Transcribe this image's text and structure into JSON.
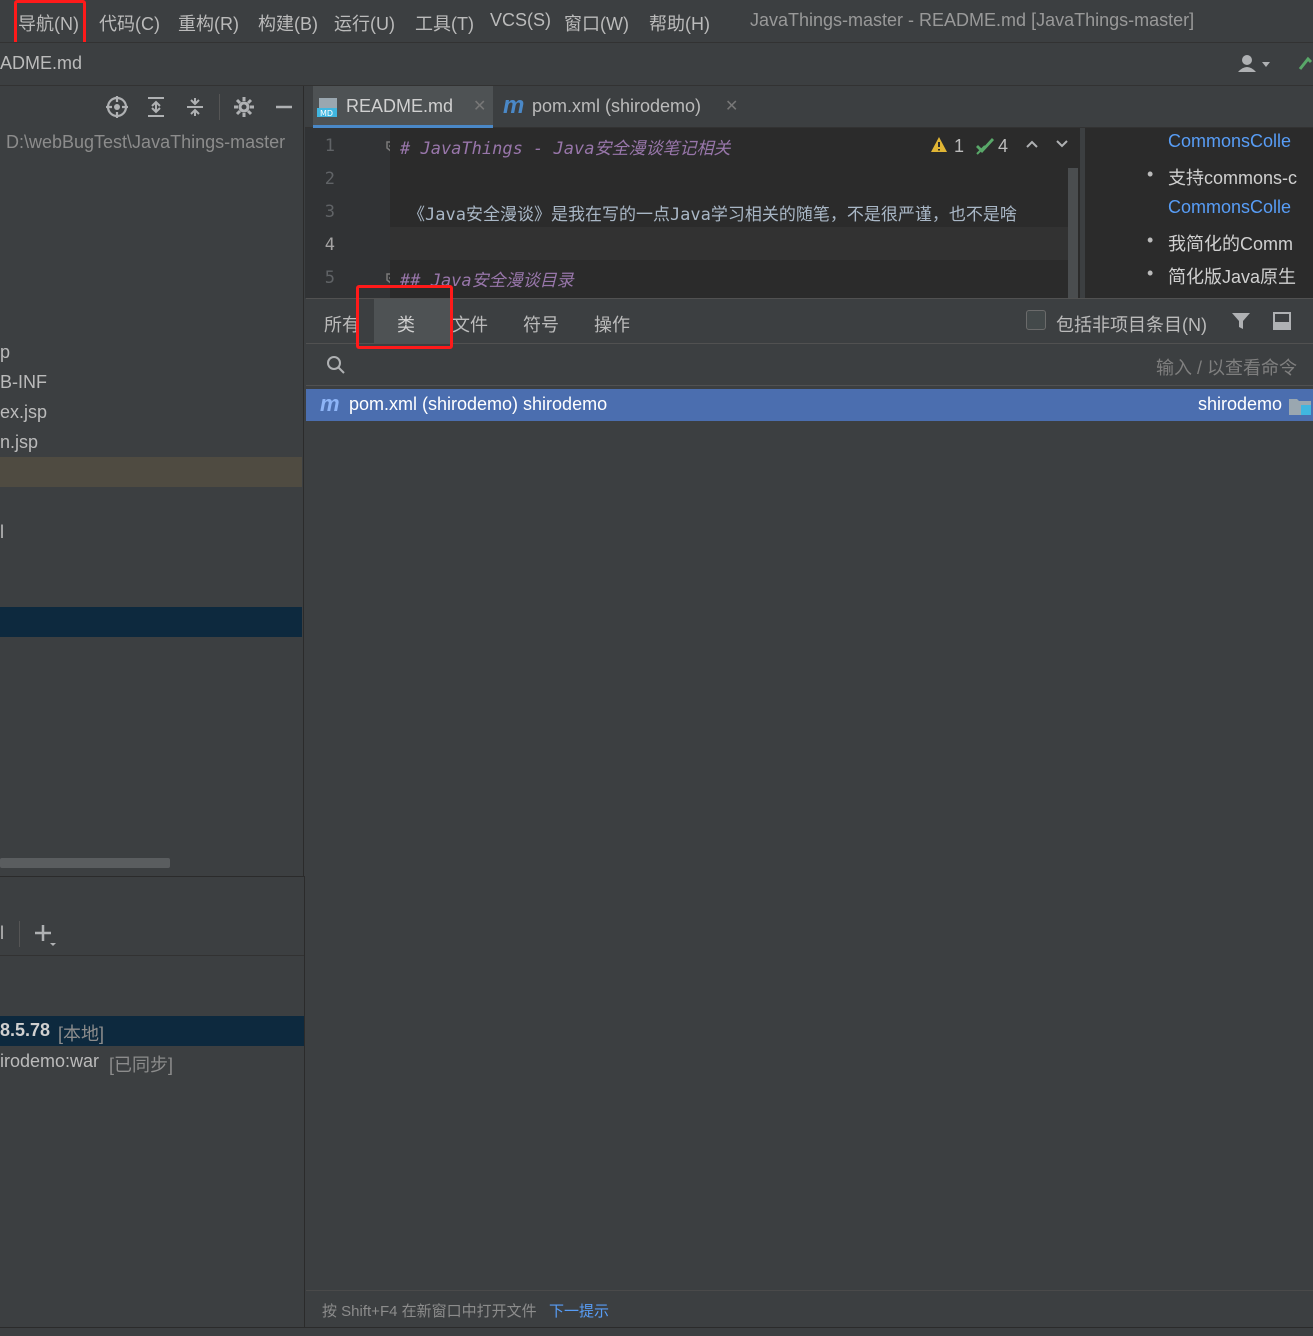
{
  "menu": {
    "items": [
      {
        "label": "导航(N)"
      },
      {
        "label": "代码(C)"
      },
      {
        "label": "重构(R)"
      },
      {
        "label": "构建(B)"
      },
      {
        "label": "运行(U)"
      },
      {
        "label": "工具(T)"
      },
      {
        "label": "VCS(S)"
      },
      {
        "label": "窗口(W)"
      },
      {
        "label": "帮助(H)"
      }
    ],
    "window_title": "JavaThings-master - README.md [JavaThings-master]"
  },
  "navbar": {
    "breadcrumb": "ADME.md"
  },
  "project": {
    "path": "D:\\webBugTest\\JavaThings-master",
    "tree": [
      "p",
      "B-INF",
      "ex.jsp",
      "n.jsp",
      "l"
    ]
  },
  "services": {
    "tab_fragment": "l",
    "items": [
      {
        "name": "8.5.78",
        "tag": "[本地]"
      },
      {
        "name": "irodemo:war",
        "tag": "[已同步]"
      }
    ]
  },
  "editor": {
    "tabs": [
      {
        "label": "README.md",
        "icon": "markdown-icon"
      },
      {
        "label": "pom.xml (shirodemo)",
        "icon": "maven-icon"
      }
    ],
    "line_numbers": [
      "1",
      "2",
      "3",
      "4",
      "5"
    ],
    "lines": [
      "# JavaThings - Java安全漫谈笔记相关",
      "",
      "《Java安全漫谈》是我在写的一点Java学习相关的随笔，不是很严谨，也不是啥",
      "",
      "## Java安全漫谈目录"
    ],
    "warnings": "1",
    "checks": "4",
    "preview": [
      {
        "text": "CommonsColle",
        "type": "link"
      },
      {
        "text": "支持commons-c",
        "type": "bullet"
      },
      {
        "text": "CommonsColle",
        "type": "link"
      },
      {
        "text": "我简化的Comm",
        "type": "bullet"
      },
      {
        "text": "简化版Java原生",
        "type": "bullet"
      }
    ]
  },
  "search": {
    "tabs": [
      "所有",
      "类",
      "文件",
      "符号",
      "操作"
    ],
    "include_non_project": "包括非项目条目(N)",
    "placeholder_hint": "输入 / 以查看命令",
    "results": [
      {
        "name": "pom.xml (shirodemo) shirodemo",
        "location": "shirodemo"
      }
    ],
    "status_hint": "按 Shift+F4 在新窗口中打开文件",
    "next_tip": "下一提示"
  },
  "colors": {
    "selection": "#4b6eaf",
    "link": "#589df6",
    "heading": "#9876aa",
    "warning": "#e0b534",
    "check": "#59a869",
    "highlight_red": "#ff1a1a"
  }
}
